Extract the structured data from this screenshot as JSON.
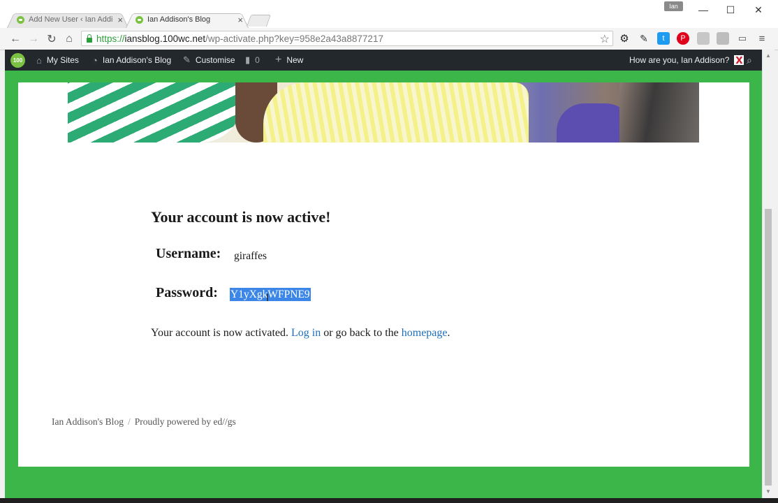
{
  "browser": {
    "tabs": [
      {
        "title": "Add New User ‹ Ian Addison",
        "active": false
      },
      {
        "title": "Ian Addison's Blog",
        "active": true
      }
    ],
    "profile_name": "Ian",
    "url": {
      "scheme": "https://",
      "host": "iansblog.100wc.net",
      "path": "/wp-activate.php?key=958e2a43a8877217"
    },
    "window_controls": {
      "minimize": "—",
      "maximize": "☐",
      "close": "✕"
    }
  },
  "adminbar": {
    "logo_text": "100",
    "my_sites": "My Sites",
    "site_name": "Ian Addison's Blog",
    "customise": "Customise",
    "comments_count": "0",
    "new": "New",
    "greeting": "How are you, Ian Addison?"
  },
  "page": {
    "heading": "Your account is now active!",
    "username_label": "Username:",
    "username_value": "giraffes",
    "password_label": "Password:",
    "password_value": "Y1yXgkWFPNE9",
    "message_prefix": "Your account is now activated.",
    "login_link": "Log in",
    "message_middle": "or go back to the",
    "homepage_link": "homepage",
    "message_suffix": "."
  },
  "footer": {
    "site_name": "Ian Addison's Blog",
    "separator": "/",
    "powered_by": "Proudly powered by ed//gs"
  },
  "colors": {
    "page_background": "#3cb648",
    "adminbar": "#23282d",
    "link": "#1f6fb8",
    "selection": "#3b86e6"
  }
}
